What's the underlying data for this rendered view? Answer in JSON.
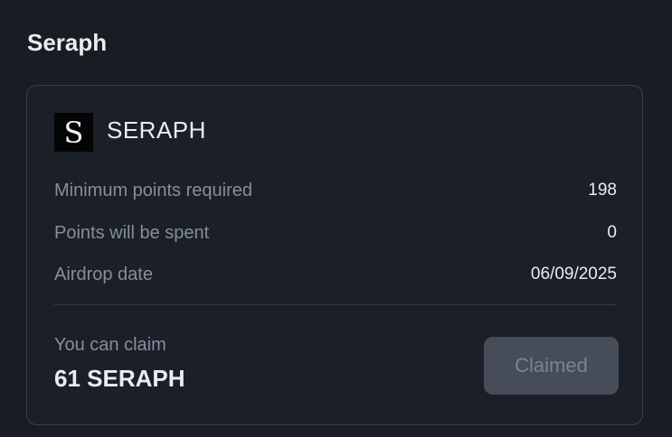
{
  "section": {
    "title": "Seraph"
  },
  "card": {
    "token": {
      "logo_icon": "seraph-logo-icon",
      "logo_letter": "S",
      "name": "SERAPH"
    },
    "details": [
      {
        "label": "Minimum points required",
        "value": "198"
      },
      {
        "label": "Points will be spent",
        "value": "0"
      },
      {
        "label": "Airdrop date",
        "value": "06/09/2025"
      }
    ],
    "claim": {
      "label": "You can claim",
      "amount": "61 SERAPH",
      "button_label": "Claimed",
      "button_state": "disabled"
    }
  },
  "colors": {
    "background": "#181d24",
    "card_border": "#3a404a",
    "primary_text": "#eaecef",
    "secondary_text": "#848e9c",
    "button_disabled_bg": "#464d58",
    "button_disabled_text": "#7b8390"
  }
}
